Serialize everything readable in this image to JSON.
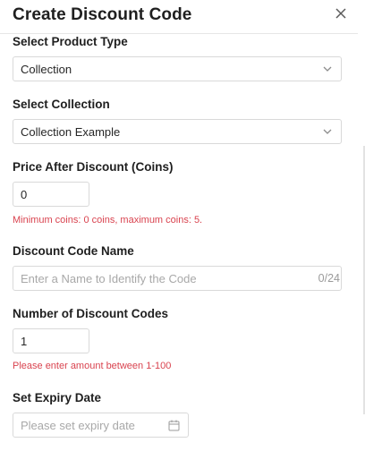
{
  "modal": {
    "title": "Create Discount Code"
  },
  "product_type": {
    "label": "Select Product Type",
    "value": "Collection"
  },
  "collection": {
    "label": "Select Collection",
    "value": "Collection Example"
  },
  "price": {
    "label": "Price After Discount (Coins)",
    "value": "0",
    "help": "Minimum coins: 0 coins, maximum coins: 5."
  },
  "code_name": {
    "label": "Discount Code Name",
    "placeholder": "Enter a Name to Identify the Code",
    "counter": "0/24"
  },
  "code_count": {
    "label": "Number of Discount Codes",
    "value": "1",
    "help": "Please enter amount between 1-100"
  },
  "expiry": {
    "label": "Set Expiry Date",
    "placeholder": "Please set expiry date"
  },
  "icons": {
    "close": "close-icon",
    "chevron": "chevron-down-icon",
    "calendar": "calendar-icon"
  },
  "colors": {
    "error": "#d9434f",
    "border": "#d9d9d9",
    "placeholder": "#a8a8a8"
  }
}
